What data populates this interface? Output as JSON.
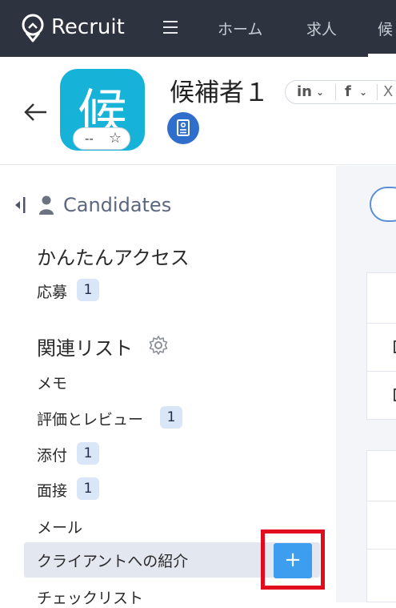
{
  "app": {
    "brand": "Recruit"
  },
  "nav": {
    "items": [
      "ホーム",
      "求人",
      "候"
    ]
  },
  "candidate": {
    "avatar_char": "候",
    "name": "候補者１",
    "rating": "--",
    "social": [
      "in",
      "f",
      "X"
    ]
  },
  "sidebar": {
    "module_title": "Candidates",
    "quick_access_title": "かんたんアクセス",
    "quick_access": [
      {
        "label": "応募",
        "count": "1"
      }
    ],
    "related_title": "関連リスト",
    "related": [
      {
        "label": "メモ"
      },
      {
        "label": "評価とレビュー",
        "count": "1"
      },
      {
        "label": "添付",
        "count": "1"
      },
      {
        "label": "面接",
        "count": "1"
      },
      {
        "label": "メール"
      },
      {
        "label": "クライアントへの紹介",
        "highlighted": true,
        "add_label": "+"
      },
      {
        "label": "チェックリスト"
      }
    ]
  },
  "colors": {
    "topbar": "#2d3440",
    "accent": "#3d9ef0",
    "avatar": "#16b2d8",
    "highlight_box": "#e10c1d"
  }
}
